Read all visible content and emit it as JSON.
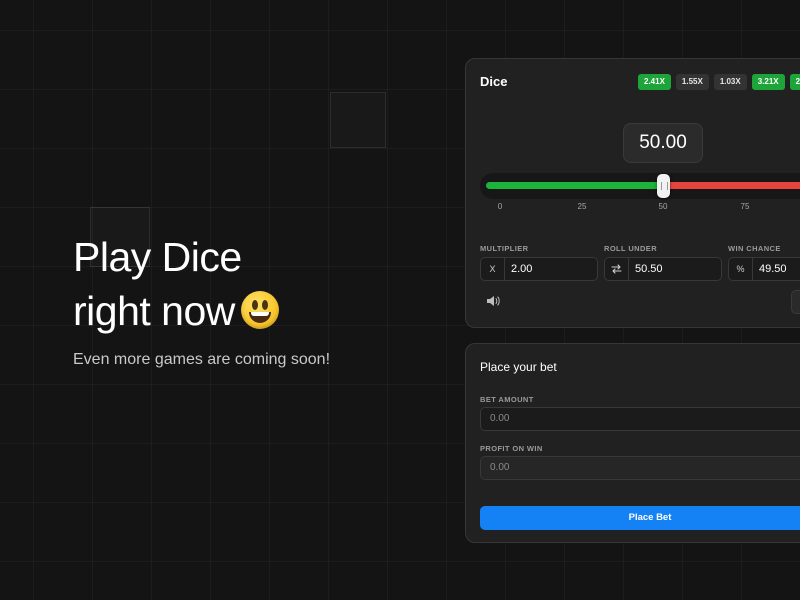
{
  "hero": {
    "title_line1": "Play Dice",
    "title_line2": "right now",
    "emoji": "grinning-face",
    "subtitle": "Even more games are coming soon!"
  },
  "dice_panel": {
    "title": "Dice",
    "history": [
      {
        "label": "2.41X",
        "result": "win"
      },
      {
        "label": "1.55X",
        "result": "neutral"
      },
      {
        "label": "1.03X",
        "result": "neutral"
      },
      {
        "label": "3.21X",
        "result": "win"
      },
      {
        "label": "2",
        "result": "win"
      }
    ],
    "roll_value": "50.00",
    "slider": {
      "value": 50,
      "ticks": [
        "0",
        "25",
        "50",
        "75"
      ],
      "colors": {
        "under": "#1cb43c",
        "over": "#e8443e"
      }
    },
    "multiplier": {
      "label": "MULTIPLIER",
      "prefix": "X",
      "value": "2.00"
    },
    "roll_under": {
      "label": "ROLL UNDER",
      "prefix_icon": "swap-icon",
      "value": "50.50"
    },
    "win_chance": {
      "label": "WIN CHANCE",
      "prefix": "%",
      "value": "49.50"
    }
  },
  "bet_panel": {
    "title": "Place your bet",
    "bet_amount": {
      "label": "BET AMOUNT",
      "value": "0.00"
    },
    "profit_on_win": {
      "label": "PROFIT ON WIN",
      "value": "0.00"
    },
    "button_label": "Place Bet",
    "button_color": "#1481f5"
  }
}
